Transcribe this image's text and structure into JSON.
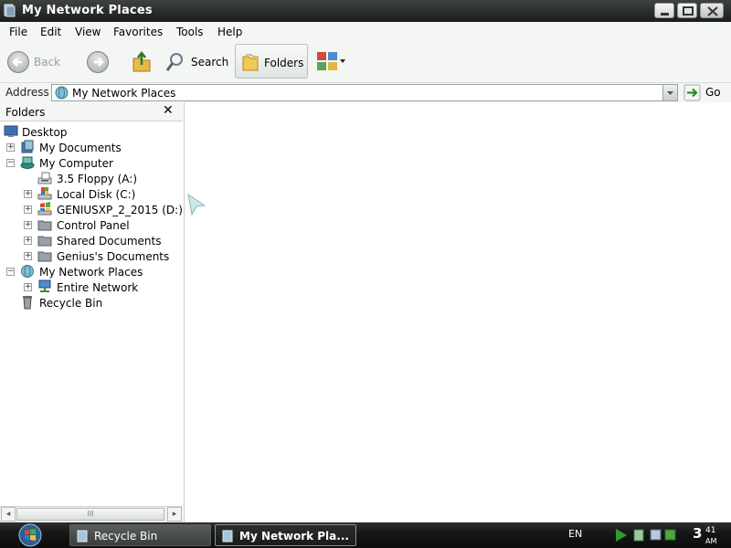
{
  "window": {
    "title": "My Network Places"
  },
  "menu": [
    "File",
    "Edit",
    "View",
    "Favorites",
    "Tools",
    "Help"
  ],
  "toolbar": {
    "back_label": "Back",
    "search_label": "Search",
    "folders_label": "Folders"
  },
  "address": {
    "label": "Address",
    "value": "My Network Places",
    "go_label": "Go"
  },
  "folders_pane": {
    "title": "Folders",
    "close_glyph": "✕",
    "tree": [
      {
        "label": "Desktop",
        "icon": "desktop-icon",
        "expander": ""
      },
      {
        "label": "My Documents",
        "icon": "my-documents-icon",
        "expander": "+"
      },
      {
        "label": "My Computer",
        "icon": "my-computer-icon",
        "expander": "−"
      },
      {
        "label": "3.5 Floppy (A:)",
        "icon": "floppy-drive-icon",
        "expander": ""
      },
      {
        "label": "Local Disk (C:)",
        "icon": "local-disk-icon",
        "expander": "+"
      },
      {
        "label": "GENIUSXP_2_2015 (D:)",
        "icon": "cd-drive-icon",
        "expander": "+"
      },
      {
        "label": "Control Panel",
        "icon": "control-panel-icon",
        "expander": "+"
      },
      {
        "label": "Shared Documents",
        "icon": "shared-folder-icon",
        "expander": "+"
      },
      {
        "label": "Genius's Documents",
        "icon": "user-folder-icon",
        "expander": "+"
      },
      {
        "label": "My Network Places",
        "icon": "network-places-icon",
        "expander": "−"
      },
      {
        "label": "Entire Network",
        "icon": "entire-network-icon",
        "expander": "+"
      },
      {
        "label": "Recycle Bin",
        "icon": "recycle-bin-icon",
        "expander": ""
      }
    ],
    "scroll_glyph": "III"
  },
  "taskbar": {
    "tasks": [
      {
        "label": "Recycle Bin",
        "icon": "recycle-bin-icon"
      },
      {
        "label": "My Network Pla...",
        "icon": "network-places-icon"
      }
    ],
    "language": "EN",
    "clock_hour": "3",
    "clock_minutes": "41",
    "clock_ampm": "AM"
  },
  "colors": {
    "titlebar": "#2a2d2b",
    "taskbar": "#151716",
    "window_bg": "#f3f6f3"
  }
}
